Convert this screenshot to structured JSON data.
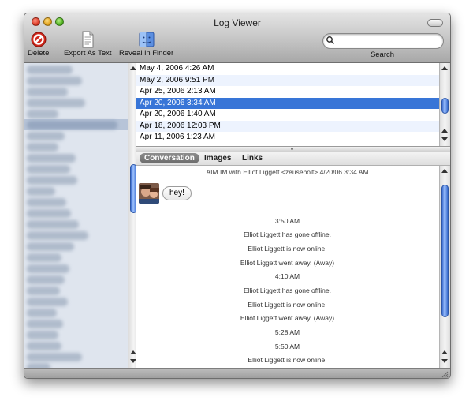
{
  "window": {
    "title": "Log Viewer"
  },
  "toolbar": {
    "delete_label": "Delete",
    "export_label": "Export As Text",
    "reveal_label": "Reveal in Finder",
    "search_label": "Search",
    "search_value": ""
  },
  "dates": [
    {
      "label": "May 4, 2006 4:26 AM"
    },
    {
      "label": "May 2, 2006 9:51 PM"
    },
    {
      "label": "Apr 25, 2006 2:13 AM"
    },
    {
      "label": "Apr 20, 2006 3:34 AM",
      "selected": true
    },
    {
      "label": "Apr 20, 2006 1:40 AM"
    },
    {
      "label": "Apr 18, 2006 12:03 PM"
    },
    {
      "label": "Apr 11, 2006 1:23 AM"
    }
  ],
  "tabs": [
    "Conversation",
    "Images",
    "Links"
  ],
  "conversation": {
    "header": "AIM IM with Elliot Liggett <zeusebolt>  4/20/06 3:34 AM",
    "message": "hey!",
    "events": [
      "3:50 AM",
      "Elliot Liggett has gone offline.",
      "Elliot Liggett is now online.",
      "Elliot Liggett went away. (Away)",
      "4:10 AM",
      "Elliot Liggett has gone offline.",
      "Elliot Liggett is now online.",
      "Elliot Liggett went away. (Away)",
      "5:28 AM",
      "5:50 AM",
      "Elliot Liggett is now online."
    ]
  },
  "colors": {
    "selection": "#3875d7",
    "scroll_thumb": "#5b8ee6",
    "delete_icon": "#d0281c"
  }
}
